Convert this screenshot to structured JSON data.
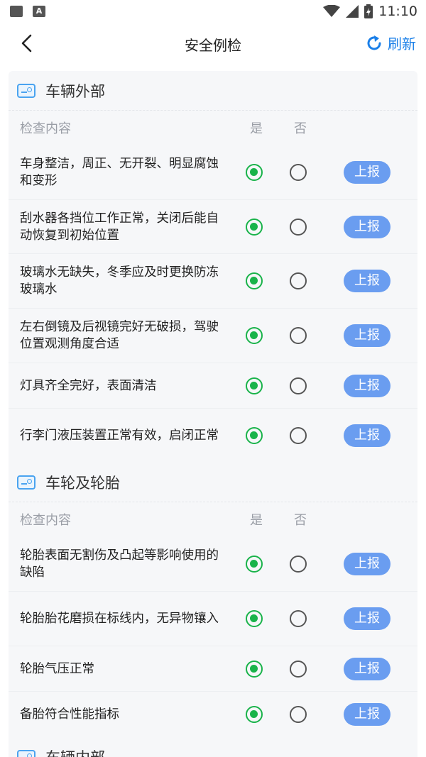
{
  "status_bar": {
    "time": "11:10"
  },
  "header": {
    "title": "安全例检",
    "refresh_label": "刷新"
  },
  "columns": {
    "content": "检查内容",
    "yes": "是",
    "no": "否"
  },
  "report_label": "上报",
  "sections": [
    {
      "title": "车辆外部",
      "items": [
        "车身整洁，周正、无开裂、明显腐蚀和变形",
        "刮水器各挡位工作正常，关闭后能自动恢复到初始位置",
        "玻璃水无缺失，冬季应及时更换防冻玻璃水",
        "左右倒镜及后视镜完好无破损，驾驶位置观测角度合适",
        "灯具齐全完好，表面清洁",
        "行李门液压装置正常有效，启闭正常"
      ]
    },
    {
      "title": "车轮及轮胎",
      "items": [
        "轮胎表面无割伤及凸起等影响使用的缺陷",
        "轮胎胎花磨损在标线内，无异物镶入",
        "轮胎气压正常",
        "备胎符合性能指标"
      ]
    },
    {
      "title": "车辆内部",
      "items": []
    }
  ]
}
